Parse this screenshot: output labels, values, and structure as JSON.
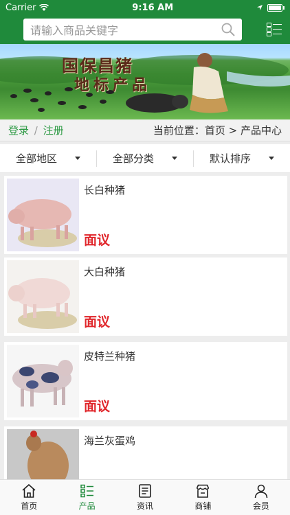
{
  "status": {
    "carrier": "Carrier",
    "time": "9:16 AM"
  },
  "search": {
    "placeholder": "请输入商品关键字"
  },
  "banner": {
    "line1": "国保昌猪",
    "line2": "地标产品"
  },
  "crumb": {
    "login": "登录",
    "sep": "/",
    "register": "注册",
    "location": "当前位置：首页 > 产品中心"
  },
  "filters": [
    {
      "label": "全部地区"
    },
    {
      "label": "全部分类"
    },
    {
      "label": "默认排序"
    }
  ],
  "products": [
    {
      "name": "长白种猪",
      "price": "面议"
    },
    {
      "name": "大白种猪",
      "price": "面议"
    },
    {
      "name": "皮特兰种猪",
      "price": "面议"
    },
    {
      "name": "海兰灰蛋鸡",
      "price": ""
    }
  ],
  "tabs": [
    {
      "label": "首页",
      "icon": "home-icon"
    },
    {
      "label": "产品",
      "icon": "list-icon"
    },
    {
      "label": "资讯",
      "icon": "news-icon"
    },
    {
      "label": "商铺",
      "icon": "shop-icon"
    },
    {
      "label": "会员",
      "icon": "user-icon"
    }
  ],
  "colors": {
    "accent": "#1f8a3b",
    "price": "#e0262b",
    "link": "#2f9b46"
  }
}
